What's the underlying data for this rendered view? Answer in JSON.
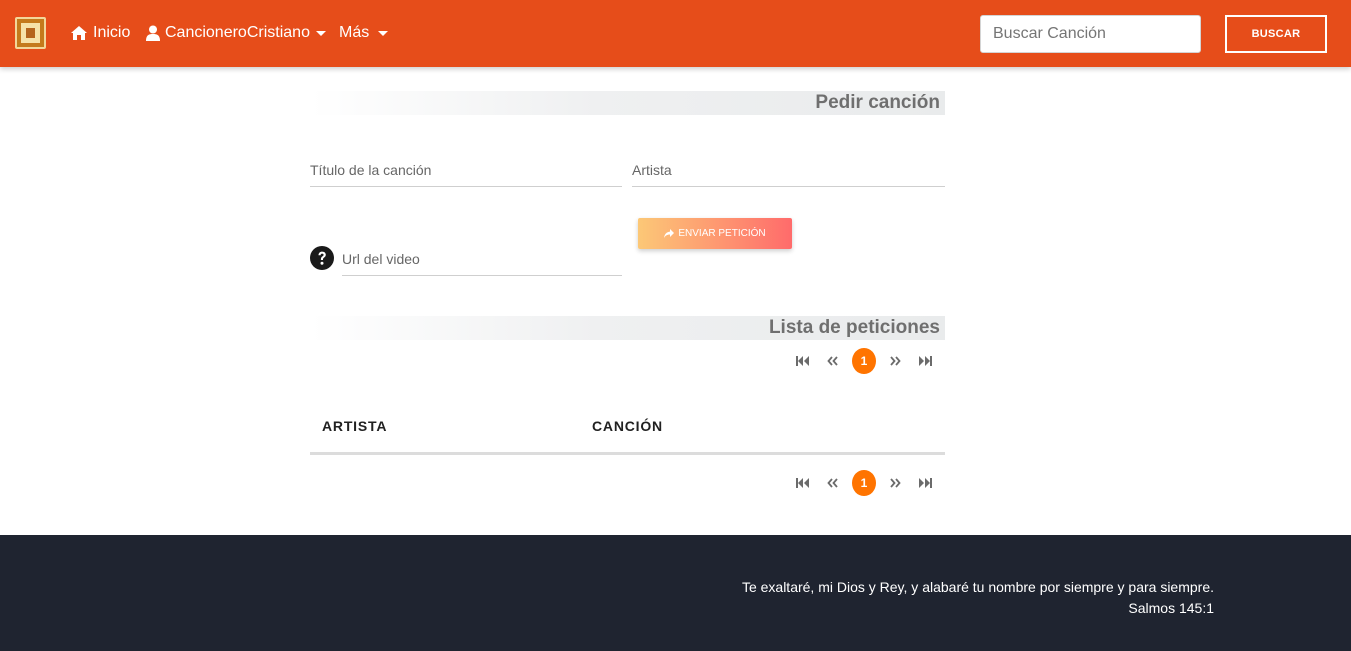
{
  "navbar": {
    "home_label": "Inicio",
    "user_label": "CancioneroCristiano",
    "more_label": "Más",
    "search_placeholder": "Buscar Canción",
    "search_button": "BUSCAR",
    "brand_color": "#e64d1a"
  },
  "request": {
    "title": "Pedir canción",
    "song_title_placeholder": "Título de la canción",
    "artist_placeholder": "Artista",
    "video_url_placeholder": "Url del video",
    "send_button": "ENVIAR PETICIÓN"
  },
  "requests_list": {
    "title": "Lista de peticiones",
    "columns": [
      "ARTISTA",
      "CANCIÓN"
    ],
    "rows": [],
    "pagination": {
      "current_page": "1",
      "accent_color": "#ff7400"
    }
  },
  "footer": {
    "verse": "Te exaltaré, mi Dios y Rey, y alabaré tu nombre por siempre y para siempre.",
    "reference": "Salmos 145:1",
    "background_color": "#1f2430"
  },
  "icons": [
    "logo",
    "home-icon",
    "user-icon",
    "question-circle-icon",
    "share-icon",
    "first-page-icon",
    "prev-page-icon",
    "next-page-icon",
    "last-page-icon"
  ]
}
